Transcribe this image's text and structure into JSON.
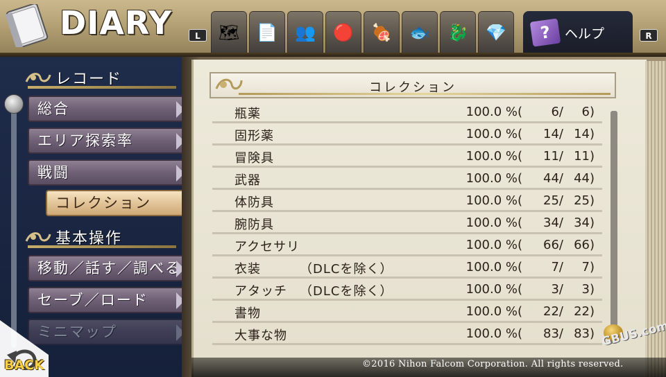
{
  "header": {
    "title": "DIARY",
    "l_button": "L",
    "r_button": "R",
    "help_label": "ヘルプ",
    "help_icon_glyph": "?",
    "tabs": [
      {
        "icon": "map-icon"
      },
      {
        "icon": "documents-icon"
      },
      {
        "icon": "people-icon"
      },
      {
        "icon": "monster-icon"
      },
      {
        "icon": "food-icon"
      },
      {
        "icon": "fish-icon"
      },
      {
        "icon": "dragon-icon"
      },
      {
        "icon": "crystal-icon"
      }
    ]
  },
  "sidebar": {
    "section_record": "レコード",
    "section_basic": "基本操作",
    "items": [
      {
        "label": "総合"
      },
      {
        "label": "エリア探索率"
      },
      {
        "label": "戦闘"
      },
      {
        "label": "コレクション",
        "selected": true
      },
      {
        "label": "移動／話す／調べる"
      },
      {
        "label": "セーブ／ロード"
      },
      {
        "label": "ミニマップ"
      }
    ],
    "back_label": "BACK"
  },
  "page": {
    "title": "コレクション",
    "rows": [
      {
        "name": "瓶薬",
        "note": "",
        "percent": "100.0 %",
        "got": "6/",
        "total": "6"
      },
      {
        "name": "固形薬",
        "note": "",
        "percent": "100.0 %",
        "got": "14/",
        "total": "14"
      },
      {
        "name": "冒険具",
        "note": "",
        "percent": "100.0 %",
        "got": "11/",
        "total": "11"
      },
      {
        "name": "武器",
        "note": "",
        "percent": "100.0 %",
        "got": "44/",
        "total": "44"
      },
      {
        "name": "体防具",
        "note": "",
        "percent": "100.0 %",
        "got": "25/",
        "total": "25"
      },
      {
        "name": "腕防具",
        "note": "",
        "percent": "100.0 %",
        "got": "34/",
        "total": "34"
      },
      {
        "name": "アクセサリ",
        "note": "",
        "percent": "100.0 %",
        "got": "66/",
        "total": "66"
      },
      {
        "name": "衣装",
        "note": "（DLCを除く）",
        "percent": "100.0 %",
        "got": "7/",
        "total": "7"
      },
      {
        "name": "アタッチ",
        "note": "（DLCを除く）",
        "percent": "100.0 %",
        "got": "3/",
        "total": "3"
      },
      {
        "name": "書物",
        "note": "",
        "percent": "100.0 %",
        "got": "22/",
        "total": "22"
      },
      {
        "name": "大事な物",
        "note": "",
        "percent": "100.0 %",
        "got": "83/",
        "total": "83"
      }
    ],
    "open_paren": "(",
    "close_paren": ")"
  },
  "footer": {
    "copyright": "©2016 Nihon Falcom Corporation. All rights reserved."
  },
  "watermark": "GBUS.com",
  "colors": {
    "accent_gold": "#c6ad6a",
    "selected_tab": "#e2c499",
    "menu_purple": "#6f6075",
    "panel_navy": "#1f2c4a",
    "page_paper": "#eeeadb"
  }
}
